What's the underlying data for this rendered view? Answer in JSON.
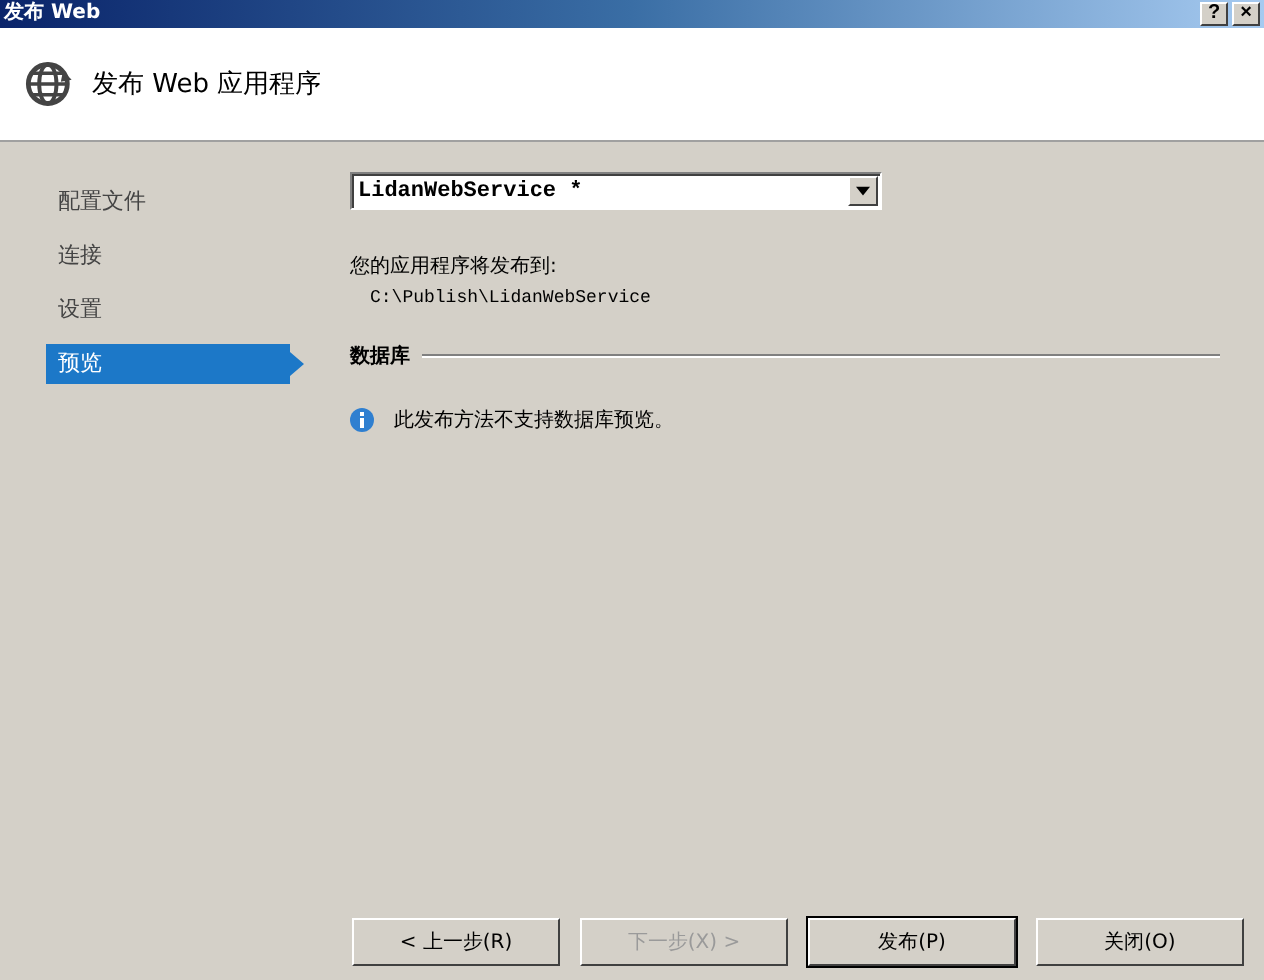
{
  "window": {
    "title": "发布 Web",
    "help_button": "?",
    "close_button": "×"
  },
  "header": {
    "title": "发布 Web 应用程序"
  },
  "sidebar": {
    "items": [
      {
        "label": "配置文件",
        "selected": false
      },
      {
        "label": "连接",
        "selected": false
      },
      {
        "label": "设置",
        "selected": false
      },
      {
        "label": "预览",
        "selected": true
      }
    ]
  },
  "profile": {
    "value": "LidanWebService *"
  },
  "publish_target": {
    "label": "您的应用程序将发布到:",
    "path": "C:\\Publish\\LidanWebService"
  },
  "database": {
    "heading": "数据库",
    "message": "此发布方法不支持数据库预览。"
  },
  "buttons": [
    {
      "label": "< 上一步(R)",
      "disabled": false,
      "default": false
    },
    {
      "label": "下一步(X) >",
      "disabled": true,
      "default": false
    },
    {
      "label": "发布(P)",
      "disabled": false,
      "default": true
    },
    {
      "label": "关闭(O)",
      "disabled": false,
      "default": false
    }
  ]
}
